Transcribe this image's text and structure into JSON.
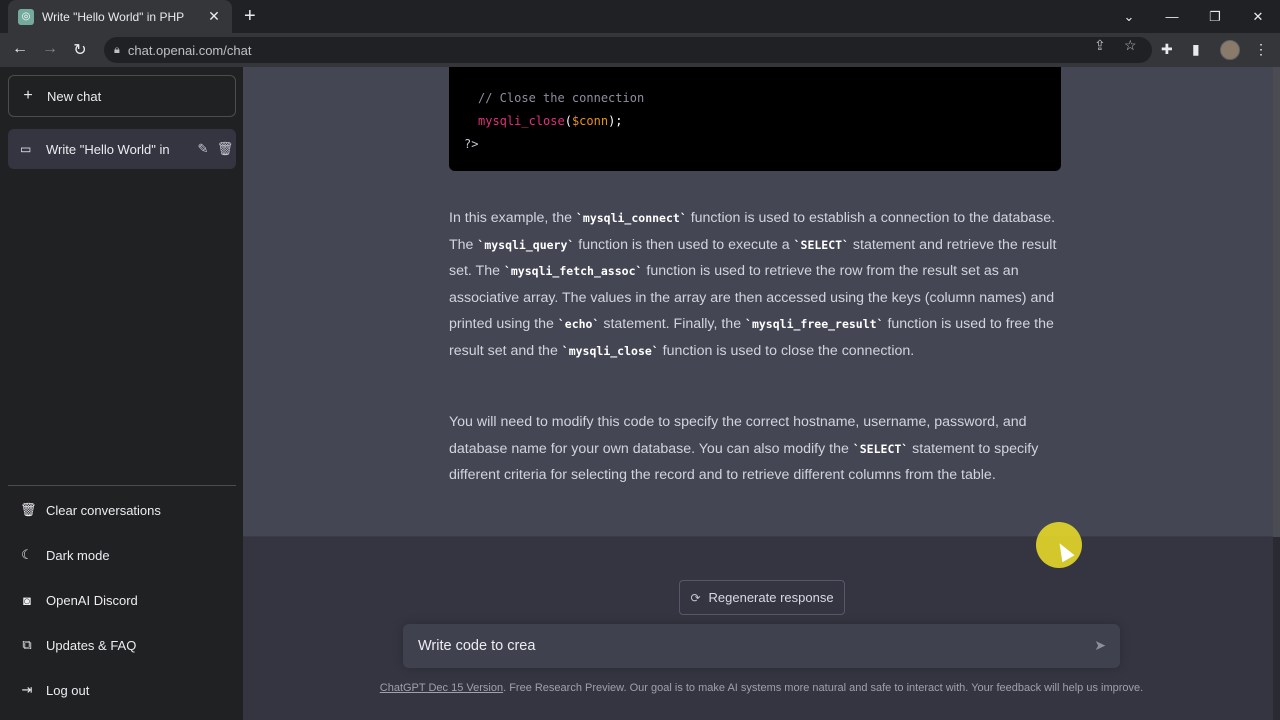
{
  "browser": {
    "tab_title": "Write \"Hello World\" in PHP",
    "tab_close": "✕",
    "new_tab": "+",
    "url": "chat.openai.com/chat",
    "controls": {
      "list": "⌄",
      "minimize": "—",
      "restore": "❐",
      "close": "✕"
    }
  },
  "sidebar": {
    "new_chat_label": "New chat",
    "conversation_title": "Write \"Hello World\" in",
    "items": [
      {
        "label": "Clear conversations",
        "icon": "trash-icon"
      },
      {
        "label": "Dark mode",
        "icon": "moon-icon"
      },
      {
        "label": "OpenAI Discord",
        "icon": "discord-icon"
      },
      {
        "label": "Updates & FAQ",
        "icon": "external-link-icon"
      },
      {
        "label": "Log out",
        "icon": "logout-icon"
      }
    ]
  },
  "code": {
    "comment": "// Close the connection",
    "fn": "mysqli_close",
    "open": "(",
    "var": "$conn",
    "close": ");",
    "end_tag": "?>"
  },
  "paragraph1": {
    "t1": "In this example, the ",
    "c1": "`mysqli_connect`",
    "t2": " function is used to establish a connection to the database. The ",
    "c2": "`mysqli_query`",
    "t3": " function is then used to execute a ",
    "c3": "`SELECT`",
    "t4": " statement and retrieve the result set. The ",
    "c4": "`mysqli_fetch_assoc`",
    "t5": " function is used to retrieve the row from the result set as an associative array. The values in the array are then accessed using the keys (column names) and printed using the ",
    "c5": "`echo`",
    "t6": " statement. Finally, the ",
    "c6": "`mysqli_free_result`",
    "t7": " function is used to free the result set and the ",
    "c7": "`mysqli_close`",
    "t8": " function is used to close the connection."
  },
  "paragraph2": {
    "t1": "You will need to modify this code to specify the correct hostname, username, password, and database name for your own database. You can also modify the ",
    "c1": "`SELECT`",
    "t2": " statement to specify different criteria for selecting the record and to retrieve different columns from the table."
  },
  "regenerate_label": "Regenerate response",
  "input_value": "Write code to crea",
  "footer": {
    "link": "ChatGPT Dec 15 Version",
    "text": ". Free Research Preview. Our goal is to make AI systems more natural and safe to interact with. Your feedback will help us improve."
  }
}
